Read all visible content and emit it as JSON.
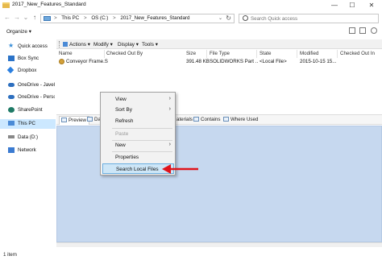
{
  "window": {
    "title": "2017_New_Features_Standard",
    "buttons": {
      "minimize": "—",
      "maximize": "☐",
      "close": "✕"
    }
  },
  "address": {
    "crumbs": [
      "This PC",
      "OS (C:)",
      "2017_New_Features_Standard"
    ],
    "separator": ">",
    "search_placeholder": "Search Quick access"
  },
  "toolbar": {
    "organize_label": "Organize ▾"
  },
  "nav_pane": {
    "items": [
      {
        "label": "Quick access",
        "icon": "star-icon",
        "color": "#3b8fd8"
      },
      {
        "label": "Box Sync",
        "icon": "box-icon",
        "color": "#2b73c8"
      },
      {
        "label": "Dropbox",
        "icon": "dropbox-icon",
        "color": "#2b7fe0"
      },
      {
        "label": "OneDrive - Javelin",
        "icon": "cloud-icon",
        "color": "#2d6fbf"
      },
      {
        "label": "OneDrive - Personal",
        "icon": "cloud-icon",
        "color": "#2d6fbf"
      },
      {
        "label": "SharePoint",
        "icon": "sharepoint-icon",
        "color": "#1f7a66"
      },
      {
        "label": "This PC",
        "icon": "computer-icon",
        "color": "#4a8ad6"
      },
      {
        "label": "Data (D:)",
        "icon": "drive-icon",
        "color": "#888888"
      },
      {
        "label": "Network",
        "icon": "network-icon",
        "color": "#3b7bd1"
      }
    ],
    "selected_index": 6
  },
  "pdm_toolbar": {
    "items": [
      "Actions ▾",
      "Modify ▾",
      "Display ▾",
      "Tools ▾"
    ]
  },
  "file_list": {
    "columns": [
      "Name",
      "Checked Out By",
      "Size",
      "File Type",
      "State",
      "Modified",
      "Checked Out In"
    ],
    "rows": [
      [
        "Conveyor Frame.SLDPRT",
        "",
        "391.48 KB",
        "SOLIDWORKS Part ...",
        "<Local File>",
        "2015-10-15 15...",
        ""
      ]
    ]
  },
  "bottom_tabs": {
    "tabs": [
      "Preview",
      "Da",
      "aterials",
      "Contains",
      "Where Used"
    ],
    "active_index": 0
  },
  "context_menu": {
    "items": [
      {
        "label": "View",
        "submenu": true,
        "disabled": false
      },
      {
        "label": "Sort By",
        "submenu": true,
        "disabled": false
      },
      {
        "label": "Refresh",
        "submenu": false,
        "disabled": false
      },
      {
        "label": "Paste",
        "submenu": false,
        "disabled": true
      },
      {
        "label": "New",
        "submenu": true,
        "disabled": false
      },
      {
        "label": "Properties",
        "submenu": false,
        "disabled": false
      },
      {
        "label": "Search Local Files",
        "submenu": false,
        "disabled": false,
        "highlighted": true
      }
    ]
  },
  "status_bar": {
    "text": "1 item"
  },
  "colors": {
    "preview_bg": "#c6d8ef",
    "selection": "#cce8ff",
    "highlight": "#cde6f7",
    "arrow": "#e0141b"
  }
}
